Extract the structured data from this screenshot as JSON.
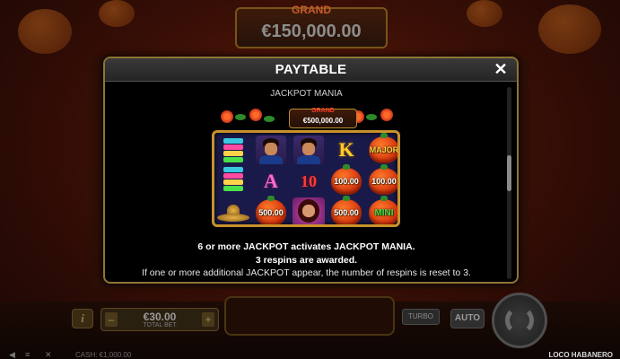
{
  "background": {
    "grand_label": "GRAND",
    "grand_value": "€150,000.00",
    "total_bet_value": "€30.00",
    "total_bet_label": "TOTAL BET",
    "info_icon": "i",
    "minus_label": "–",
    "plus_label": "+",
    "turbo_label": "TURBO",
    "auto_label": "AUTO",
    "cash_text": "CASH: €1,000.00",
    "game_name": "LOCO HABANERO"
  },
  "modal": {
    "title": "PAYTABLE",
    "close_icon": "✕",
    "section_title": "JACKPOT MANIA",
    "illustration": {
      "grand_label": "GRAND",
      "grand_value": "€500,000.00",
      "symbols": {
        "col2": [
          "man",
          "A",
          "500.00"
        ],
        "col3": [
          "man",
          "10",
          "woman"
        ],
        "col4": [
          "K",
          "100.00",
          "500.00"
        ],
        "col5": [
          "MAJOR",
          "100.00",
          "MINI"
        ]
      }
    },
    "description": [
      "6 or more JACKPOT activates JACKPOT MANIA.",
      "3 respins are awarded.",
      "If one or more additional JACKPOT appear, the number of respins is reset to 3."
    ]
  },
  "colors": {
    "modal_border": "#8d7535",
    "modal_background": "#000000",
    "reel_frame": "#c9912a",
    "pepper": "#d3300c",
    "major_text": "#ffd24a",
    "mini_text": "#3ae04a"
  }
}
